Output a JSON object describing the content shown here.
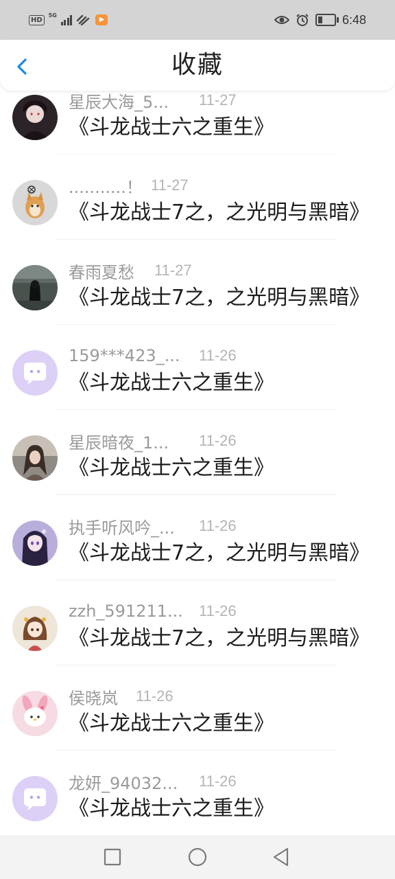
{
  "status_bar": {
    "hd": "HD",
    "network": "5G",
    "time": "6:48"
  },
  "header": {
    "title": "收藏",
    "accent": "#1e88e5"
  },
  "items": [
    {
      "user": "星辰大海_5...",
      "date": "11-27",
      "title": "《斗龙战士六之重生》",
      "avatar": "dark-girl-avatar"
    },
    {
      "user": "...........！",
      "date": "11-27",
      "title": "《斗龙战士7之，之光明与黑暗》",
      "avatar": "shiba-dog-avatar"
    },
    {
      "user": "春雨夏愁",
      "date": "11-27",
      "title": "《斗龙战士7之，之光明与黑暗》",
      "avatar": "dark-figure-avatar"
    },
    {
      "user": "159***423_...",
      "date": "11-26",
      "title": "《斗龙战士六之重生》",
      "avatar": "default-chat-avatar"
    },
    {
      "user": "星辰暗夜_1...",
      "date": "11-26",
      "title": "《斗龙战士六之重生》",
      "avatar": "photo-girl-avatar"
    },
    {
      "user": "执手听风吟_...",
      "date": "11-26",
      "title": "《斗龙战士7之，之光明与黑暗》",
      "avatar": "anime-girl-avatar"
    },
    {
      "user": "zzh_591211...",
      "date": "11-26",
      "title": "《斗龙战士7之，之光明与黑暗》",
      "avatar": "anime-doll-avatar"
    },
    {
      "user": "侯晓岚",
      "date": "11-26",
      "title": "《斗龙战士六之重生》",
      "avatar": "pink-character-avatar"
    },
    {
      "user": "龙妍_94032...",
      "date": "11-26",
      "title": "《斗龙战士六之重生》",
      "avatar": "default-chat-avatar"
    }
  ],
  "nav_bar": {
    "buttons": [
      "recent-apps",
      "home",
      "back"
    ]
  }
}
